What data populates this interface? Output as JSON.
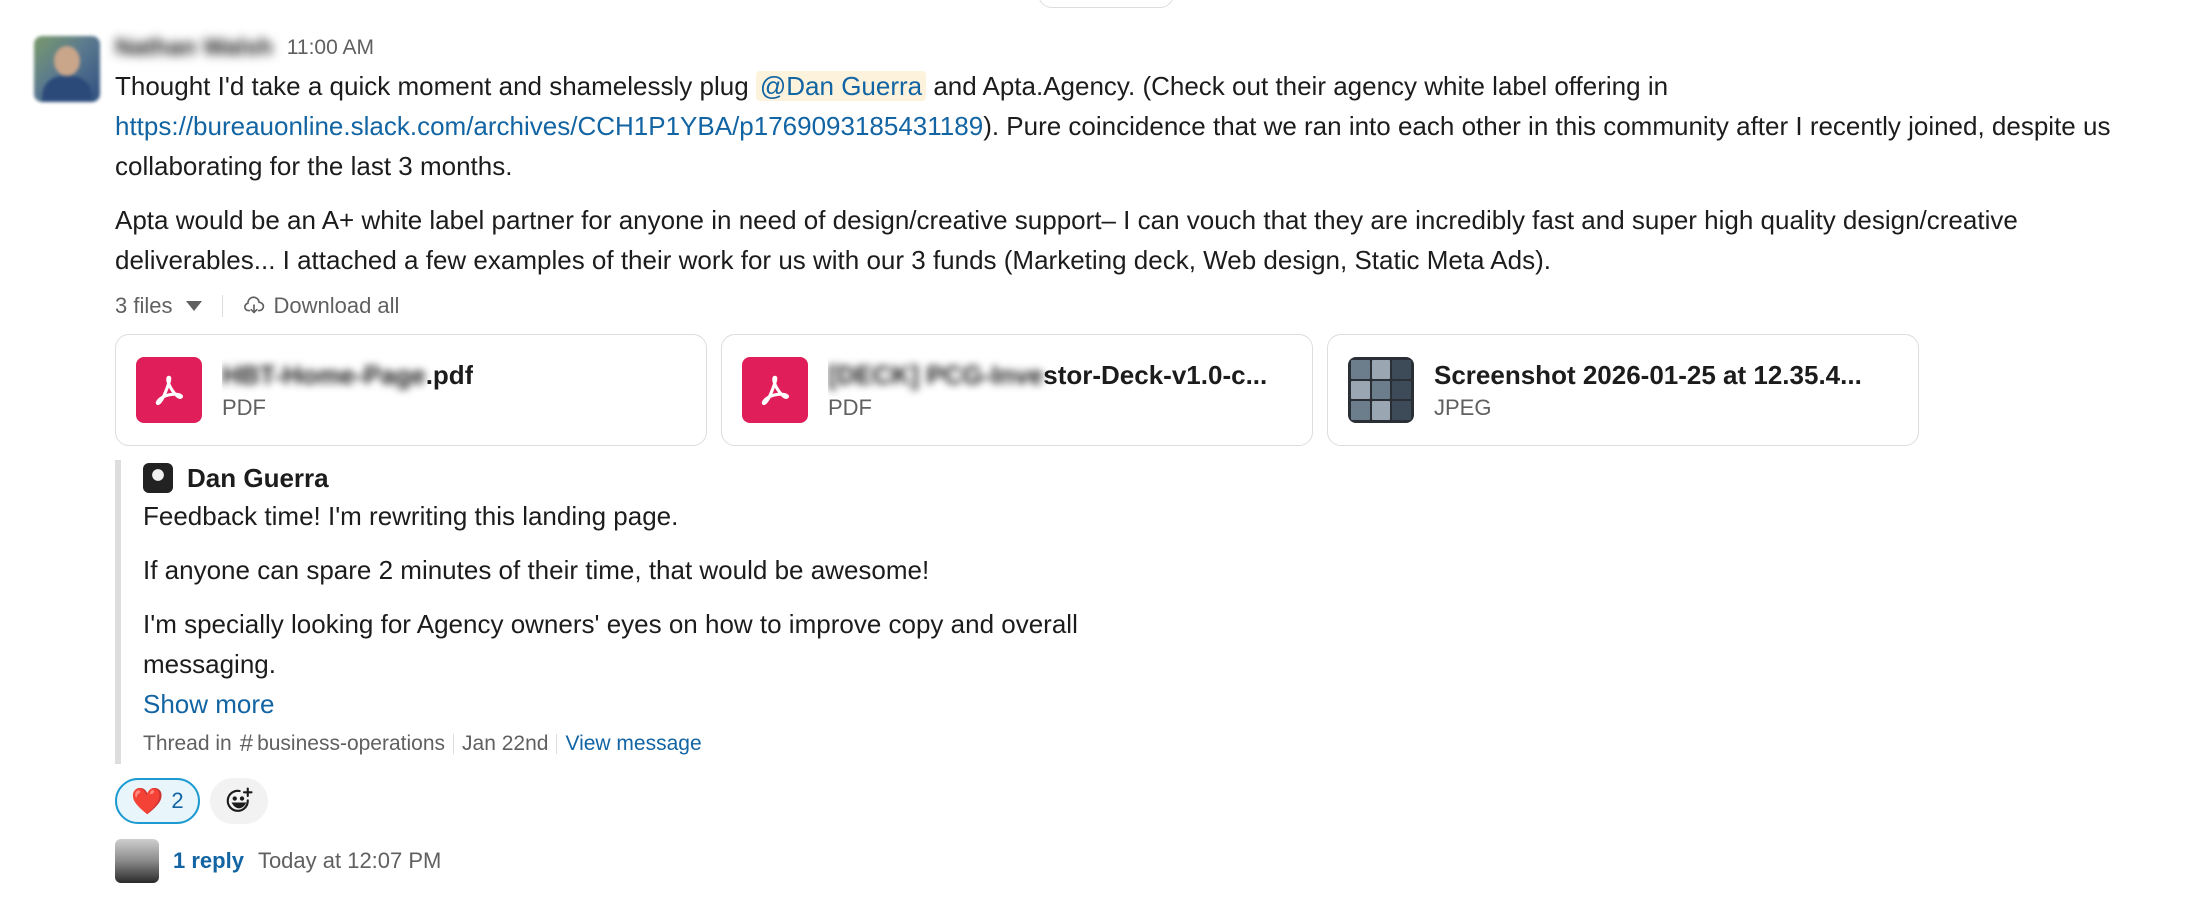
{
  "message": {
    "sender": "Nathan Walsh",
    "time": "11:00 AM",
    "p1": {
      "before": "Thought I'd take a quick moment and shamelessly plug ",
      "mention": "@Dan Guerra",
      "after_mention": " and Apta.Agency. (Check out their agency white label offering in ",
      "link": "https://bureauonline.slack.com/archives/CCH1P1YBA/p1769093185431189",
      "after_link": "). Pure coincidence that we ran into each other in this community after I recently joined, despite us collaborating for the last 3 months."
    },
    "p2": "Apta would be an A+ white label partner for anyone in need of design/creative support– I can vouch that they are incredibly fast and super high quality design/creative deliverables... I attached a few examples of their work for us with our 3 funds (Marketing deck, Web design, Static Meta Ads)."
  },
  "files_bar": {
    "count": "3 files",
    "download_all": "Download all"
  },
  "files": [
    {
      "name_blurred": "HBT-Home-Page",
      "name_visible": ".pdf",
      "type": "PDF",
      "icon": "pdf-icon"
    },
    {
      "name_blurred": "[DECK] PCG-Inve",
      "name_visible": "stor-Deck-v1.0-c...",
      "type": "PDF",
      "icon": "pdf-icon"
    },
    {
      "name_blurred": "",
      "name_visible": "Screenshot 2026-01-25 at 12.35.4...",
      "type": "JPEG",
      "icon": "image-thumbnail"
    }
  ],
  "quote": {
    "author": "Dan Guerra",
    "paragraphs": [
      "Feedback time! I'm rewriting this landing page.",
      "If anyone can spare 2 minutes of their time, that would be awesome!",
      "I'm specially looking for Agency owners' eyes on how to improve copy and overall messaging."
    ],
    "show_more": "Show more",
    "thread_in": "Thread in",
    "channel": "business-operations",
    "date": "Jan 22nd",
    "view_message": "View message"
  },
  "reactions": [
    {
      "emoji": "heart",
      "count": "2",
      "color": "#e01e5a"
    }
  ],
  "replies": {
    "count": "1 reply",
    "time": "Today at 12:07 PM"
  }
}
